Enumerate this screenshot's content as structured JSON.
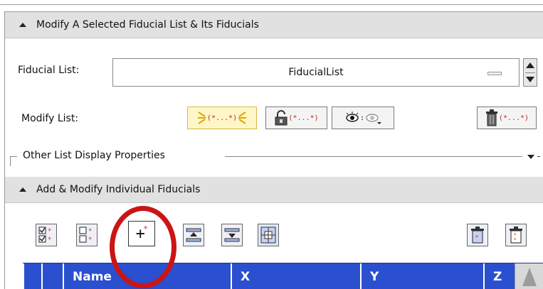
{
  "modify_section": {
    "title": "Modify A Selected Fiducial List & Its Fiducials",
    "fiducial_list_label": "Fiducial List:",
    "fiducial_list_value": "FiducialList",
    "modify_list_label": "Modify List:",
    "buttons": {
      "select_all_label": "(*...*)",
      "lock_label": "(*...*)",
      "visibility_label": ":",
      "delete_label": "(*...*)"
    }
  },
  "display_properties": {
    "label": "Other List Display Properties"
  },
  "fiducials_section": {
    "title": "Add & Modify Individual Fiducials",
    "add_button_label": "+"
  },
  "table": {
    "columns": [
      "Name",
      "X",
      "Y",
      "Z"
    ]
  },
  "colors": {
    "table_header": "#2a4fcf",
    "annotation": "#cc1414",
    "section_header": "#e1e1e1"
  }
}
